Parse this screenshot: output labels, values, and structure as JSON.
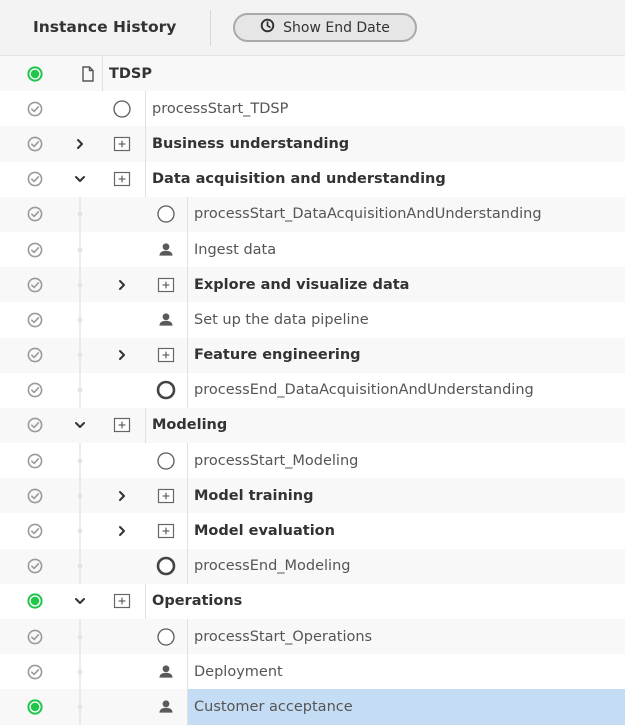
{
  "header": {
    "title": "Instance History",
    "show_end_date_label": "Show End Date",
    "show_end_date_icon": "clock-icon"
  },
  "colors": {
    "status_active": "#1ec74b",
    "status_done": "#9a9a9a",
    "selected_row": "#c5dcf5"
  },
  "rows": [
    {
      "label": "TDSP",
      "status": "active",
      "depth": 0,
      "type": "document",
      "bold": true,
      "expander": "none"
    },
    {
      "label": "processStart_TDSP",
      "status": "done",
      "depth": 1,
      "type": "start-event",
      "bold": false,
      "expander": "none"
    },
    {
      "label": "Business understanding",
      "status": "done",
      "depth": 1,
      "type": "subprocess",
      "bold": true,
      "expander": "collapsed"
    },
    {
      "label": "Data acquisition and understanding",
      "status": "done",
      "depth": 1,
      "type": "subprocess",
      "bold": true,
      "expander": "expanded"
    },
    {
      "label": "processStart_DataAcquisitionAndUnderstanding",
      "status": "done",
      "depth": 2,
      "type": "start-event",
      "bold": false,
      "expander": "none"
    },
    {
      "label": "Ingest data",
      "status": "done",
      "depth": 2,
      "type": "user-task",
      "bold": false,
      "expander": "none"
    },
    {
      "label": "Explore and visualize data",
      "status": "done",
      "depth": 2,
      "type": "subprocess",
      "bold": true,
      "expander": "collapsed"
    },
    {
      "label": "Set up the data pipeline",
      "status": "done",
      "depth": 2,
      "type": "user-task",
      "bold": false,
      "expander": "none"
    },
    {
      "label": "Feature engineering",
      "status": "done",
      "depth": 2,
      "type": "subprocess",
      "bold": true,
      "expander": "collapsed"
    },
    {
      "label": "processEnd_DataAcquisitionAndUnderstanding",
      "status": "done",
      "depth": 2,
      "type": "end-event",
      "bold": false,
      "expander": "none"
    },
    {
      "label": "Modeling",
      "status": "done",
      "depth": 1,
      "type": "subprocess",
      "bold": true,
      "expander": "expanded"
    },
    {
      "label": "processStart_Modeling",
      "status": "done",
      "depth": 2,
      "type": "start-event",
      "bold": false,
      "expander": "none"
    },
    {
      "label": "Model training",
      "status": "done",
      "depth": 2,
      "type": "subprocess",
      "bold": true,
      "expander": "collapsed"
    },
    {
      "label": "Model evaluation",
      "status": "done",
      "depth": 2,
      "type": "subprocess",
      "bold": true,
      "expander": "collapsed"
    },
    {
      "label": "processEnd_Modeling",
      "status": "done",
      "depth": 2,
      "type": "end-event",
      "bold": false,
      "expander": "none"
    },
    {
      "label": "Operations",
      "status": "active",
      "depth": 1,
      "type": "subprocess",
      "bold": true,
      "expander": "expanded"
    },
    {
      "label": "processStart_Operations",
      "status": "done",
      "depth": 2,
      "type": "start-event",
      "bold": false,
      "expander": "none"
    },
    {
      "label": "Deployment",
      "status": "done",
      "depth": 2,
      "type": "user-task",
      "bold": false,
      "expander": "none"
    },
    {
      "label": "Customer acceptance",
      "status": "active",
      "depth": 2,
      "type": "user-task",
      "bold": false,
      "expander": "none",
      "selected": true
    }
  ]
}
